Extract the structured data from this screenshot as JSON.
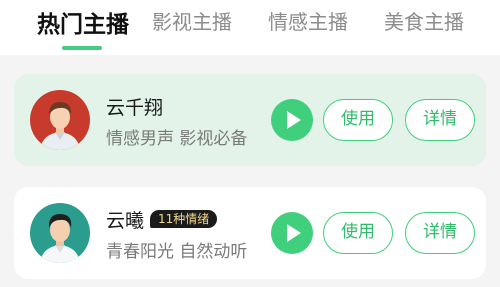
{
  "tabs": [
    {
      "label": "热门主播",
      "active": true
    },
    {
      "label": "影视主播",
      "active": false
    },
    {
      "label": "情感主播",
      "active": false
    },
    {
      "label": "美食主播",
      "active": false
    }
  ],
  "colors": {
    "accent": "#3fcf7d",
    "selected_card_bg": "#e3f3ea",
    "badge_bg": "#1b1b1b",
    "badge_text": "#f3d78a"
  },
  "anchors": [
    {
      "name": "云千翔",
      "description": "情感男声 影视必备",
      "badge": "",
      "avatar_icon": "male-anchor-avatar-icon",
      "selected": true,
      "play_icon": "play-icon",
      "use_label": "使用",
      "detail_label": "详情"
    },
    {
      "name": "云曦",
      "description": "青春阳光 自然动听",
      "badge": "11种情绪",
      "avatar_icon": "male-anchor-avatar-icon",
      "selected": false,
      "play_icon": "play-icon",
      "use_label": "使用",
      "detail_label": "详情"
    }
  ]
}
